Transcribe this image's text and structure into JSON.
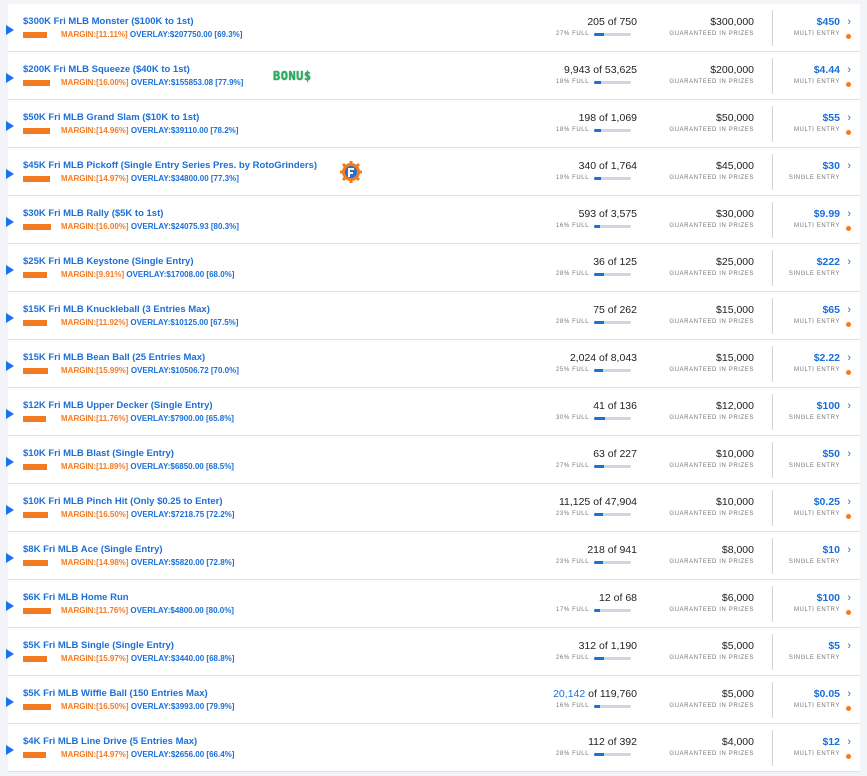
{
  "colors": {
    "accent": "#1a6fd9",
    "margin": "#f47a20",
    "dot": "#f47a20"
  },
  "contests": [
    {
      "title": "$300K Fri MLB Monster ($100K to 1st)",
      "margin": "MARGIN:[11.11%]",
      "overlay": "OVERLAY:$207750.00 [69.3%]",
      "bar": 0.69,
      "entries_current": "205",
      "entries_total": "of 750",
      "full_label": "27% FULL",
      "fill": 0.27,
      "prize": "$300,000",
      "gip": "GUARANTEED IN PRIZES",
      "fee": "$450",
      "entry_type": "MULTI ENTRY",
      "dot": true,
      "badge": "",
      "logo": false,
      "hl": false
    },
    {
      "title": "$200K Fri MLB Squeeze ($40K to 1st)",
      "margin": "MARGIN:[16.00%]",
      "overlay": "OVERLAY:$155853.08 [77.9%]",
      "bar": 0.78,
      "entries_current": "9,943",
      "entries_total": "of 53,625",
      "full_label": "18% FULL",
      "fill": 0.18,
      "prize": "$200,000",
      "gip": "GUARANTEED IN PRIZES",
      "fee": "$4.44",
      "entry_type": "MULTI ENTRY",
      "dot": true,
      "badge": "BONU$",
      "logo": false,
      "hl": false
    },
    {
      "title": "$50K Fri MLB Grand Slam ($10K to 1st)",
      "margin": "MARGIN:[14.96%]",
      "overlay": "OVERLAY:$39110.00 [78.2%]",
      "bar": 0.78,
      "entries_current": "198",
      "entries_total": "of 1,069",
      "full_label": "18% FULL",
      "fill": 0.18,
      "prize": "$50,000",
      "gip": "GUARANTEED IN PRIZES",
      "fee": "$55",
      "entry_type": "MULTI ENTRY",
      "dot": true,
      "badge": "",
      "logo": false,
      "hl": false
    },
    {
      "title": "$45K Fri MLB Pickoff (Single Entry Series Pres. by RotoGrinders)",
      "margin": "MARGIN:[14.97%]",
      "overlay": "OVERLAY:$34800.00 [77.3%]",
      "bar": 0.77,
      "entries_current": "340",
      "entries_total": "of 1,764",
      "full_label": "19% FULL",
      "fill": 0.19,
      "prize": "$45,000",
      "gip": "GUARANTEED IN PRIZES",
      "fee": "$30",
      "entry_type": "SINGLE ENTRY",
      "dot": false,
      "badge": "",
      "logo": true,
      "hl": false
    },
    {
      "title": "$30K Fri MLB Rally ($5K to 1st)",
      "margin": "MARGIN:[16.00%]",
      "overlay": "OVERLAY:$24075.93 [80.3%]",
      "bar": 0.8,
      "entries_current": "593",
      "entries_total": "of 3,575",
      "full_label": "16% FULL",
      "fill": 0.16,
      "prize": "$30,000",
      "gip": "GUARANTEED IN PRIZES",
      "fee": "$9.99",
      "entry_type": "MULTI ENTRY",
      "dot": true,
      "badge": "",
      "logo": false,
      "hl": false
    },
    {
      "title": "$25K Fri MLB Keystone (Single Entry)",
      "margin": "MARGIN:[9.91%]",
      "overlay": "OVERLAY:$17008.00 [68.0%]",
      "bar": 0.68,
      "entries_current": "36",
      "entries_total": "of 125",
      "full_label": "28% FULL",
      "fill": 0.28,
      "prize": "$25,000",
      "gip": "GUARANTEED IN PRIZES",
      "fee": "$222",
      "entry_type": "SINGLE ENTRY",
      "dot": false,
      "badge": "",
      "logo": false,
      "hl": false
    },
    {
      "title": "$15K Fri MLB Knuckleball (3 Entries Max)",
      "margin": "MARGIN:[11.92%]",
      "overlay": "OVERLAY:$10125.00 [67.5%]",
      "bar": 0.675,
      "entries_current": "75",
      "entries_total": "of 262",
      "full_label": "28% FULL",
      "fill": 0.28,
      "prize": "$15,000",
      "gip": "GUARANTEED IN PRIZES",
      "fee": "$65",
      "entry_type": "MULTI ENTRY",
      "dot": true,
      "badge": "",
      "logo": false,
      "hl": false
    },
    {
      "title": "$15K Fri MLB Bean Ball (25 Entries Max)",
      "margin": "MARGIN:[15.99%]",
      "overlay": "OVERLAY:$10506.72 [70.0%]",
      "bar": 0.7,
      "entries_current": "2,024",
      "entries_total": "of 8,043",
      "full_label": "25% FULL",
      "fill": 0.25,
      "prize": "$15,000",
      "gip": "GUARANTEED IN PRIZES",
      "fee": "$2.22",
      "entry_type": "MULTI ENTRY",
      "dot": true,
      "badge": "",
      "logo": false,
      "hl": false
    },
    {
      "title": "$12K Fri MLB Upper Decker (Single Entry)",
      "margin": "MARGIN:[11.76%]",
      "overlay": "OVERLAY:$7900.00 [65.8%]",
      "bar": 0.658,
      "entries_current": "41",
      "entries_total": "of 136",
      "full_label": "30% FULL",
      "fill": 0.3,
      "prize": "$12,000",
      "gip": "GUARANTEED IN PRIZES",
      "fee": "$100",
      "entry_type": "SINGLE ENTRY",
      "dot": false,
      "badge": "",
      "logo": false,
      "hl": false
    },
    {
      "title": "$10K Fri MLB Blast (Single Entry)",
      "margin": "MARGIN:[11.89%]",
      "overlay": "OVERLAY:$6850.00 [68.5%]",
      "bar": 0.685,
      "entries_current": "63",
      "entries_total": "of 227",
      "full_label": "27% FULL",
      "fill": 0.27,
      "prize": "$10,000",
      "gip": "GUARANTEED IN PRIZES",
      "fee": "$50",
      "entry_type": "SINGLE ENTRY",
      "dot": false,
      "badge": "",
      "logo": false,
      "hl": false
    },
    {
      "title": "$10K Fri MLB Pinch Hit (Only $0.25 to Enter)",
      "margin": "MARGIN:[16.50%]",
      "overlay": "OVERLAY:$7218.75 [72.2%]",
      "bar": 0.722,
      "entries_current": "11,125",
      "entries_total": "of 47,904",
      "full_label": "23% FULL",
      "fill": 0.23,
      "prize": "$10,000",
      "gip": "GUARANTEED IN PRIZES",
      "fee": "$0.25",
      "entry_type": "MULTI ENTRY",
      "dot": true,
      "badge": "",
      "logo": false,
      "hl": false
    },
    {
      "title": "$8K Fri MLB Ace (Single Entry)",
      "margin": "MARGIN:[14.98%]",
      "overlay": "OVERLAY:$5820.00 [72.8%]",
      "bar": 0.728,
      "entries_current": "218",
      "entries_total": "of 941",
      "full_label": "23% FULL",
      "fill": 0.23,
      "prize": "$8,000",
      "gip": "GUARANTEED IN PRIZES",
      "fee": "$10",
      "entry_type": "SINGLE ENTRY",
      "dot": false,
      "badge": "",
      "logo": false,
      "hl": false
    },
    {
      "title": "$6K Fri MLB Home Run",
      "margin": "MARGIN:[11.76%]",
      "overlay": "OVERLAY:$4800.00 [80.0%]",
      "bar": 0.8,
      "entries_current": "12",
      "entries_total": "of 68",
      "full_label": "17% FULL",
      "fill": 0.17,
      "prize": "$6,000",
      "gip": "GUARANTEED IN PRIZES",
      "fee": "$100",
      "entry_type": "MULTI ENTRY",
      "dot": true,
      "badge": "",
      "logo": false,
      "hl": false
    },
    {
      "title": "$5K Fri MLB Single (Single Entry)",
      "margin": "MARGIN:[15.97%]",
      "overlay": "OVERLAY:$3440.00 [68.8%]",
      "bar": 0.688,
      "entries_current": "312",
      "entries_total": "of 1,190",
      "full_label": "26% FULL",
      "fill": 0.26,
      "prize": "$5,000",
      "gip": "GUARANTEED IN PRIZES",
      "fee": "$5",
      "entry_type": "SINGLE ENTRY",
      "dot": false,
      "badge": "",
      "logo": false,
      "hl": false
    },
    {
      "title": "$5K Fri MLB Wiffle Ball (150 Entries Max)",
      "margin": "MARGIN:[16.50%]",
      "overlay": "OVERLAY:$3993.00 [79.9%]",
      "bar": 0.799,
      "entries_current": "20,142",
      "entries_total": "of 119,760",
      "full_label": "16% FULL",
      "fill": 0.16,
      "prize": "$5,000",
      "gip": "GUARANTEED IN PRIZES",
      "fee": "$0.05",
      "entry_type": "MULTI ENTRY",
      "dot": true,
      "badge": "",
      "logo": false,
      "hl": true
    },
    {
      "title": "$4K Fri MLB Line Drive (5 Entries Max)",
      "margin": "MARGIN:[14.97%]",
      "overlay": "OVERLAY:$2656.00 [66.4%]",
      "bar": 0.664,
      "entries_current": "112",
      "entries_total": "of 392",
      "full_label": "28% FULL",
      "fill": 0.28,
      "prize": "$4,000",
      "gip": "GUARANTEED IN PRIZES",
      "fee": "$12",
      "entry_type": "MULTI ENTRY",
      "dot": true,
      "badge": "",
      "logo": false,
      "hl": false
    }
  ]
}
